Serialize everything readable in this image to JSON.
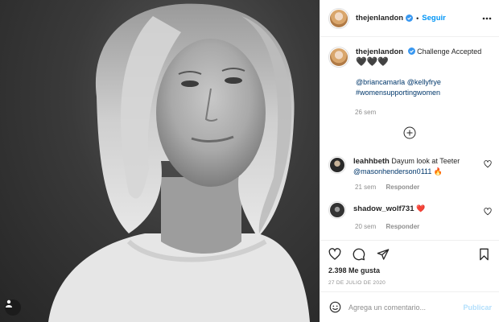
{
  "post": {
    "author": "thejenlandon",
    "follow_label": "Seguir",
    "dot": "•",
    "caption": "Challenge Accepted",
    "caption_hearts": "🖤🖤🖤",
    "caption_mentions": [
      "@briancamarla",
      "@kellyfrye",
      "#womensupportingwomen"
    ],
    "caption_time": "26 sem",
    "likes": "2.398 Me gusta",
    "date": "27 DE JULIO DE 2020"
  },
  "comments": [
    {
      "user": "leahhbeth",
      "text": "Dayum look at Teeter",
      "mention": "@masonhenderson0111",
      "emoji": "🔥",
      "time": "21 sem",
      "reply_label": "Responder"
    },
    {
      "user": "shadow_wolf731",
      "text": "",
      "emoji": "❤️",
      "time": "20 sem",
      "reply_label": "Responder"
    }
  ],
  "comment_box": {
    "placeholder": "Agrega un comentario...",
    "post_label": "Publicar"
  },
  "colors": {
    "accent": "#0095f6",
    "link": "#00376b",
    "muted": "#8e8e8e",
    "disabled_post": "#b2dffc"
  },
  "icons": [
    "user-tag-icon",
    "verified-icon",
    "more-options-icon",
    "load-more-icon",
    "heart-icon",
    "comment-icon",
    "share-icon",
    "bookmark-icon",
    "emoji-icon"
  ]
}
